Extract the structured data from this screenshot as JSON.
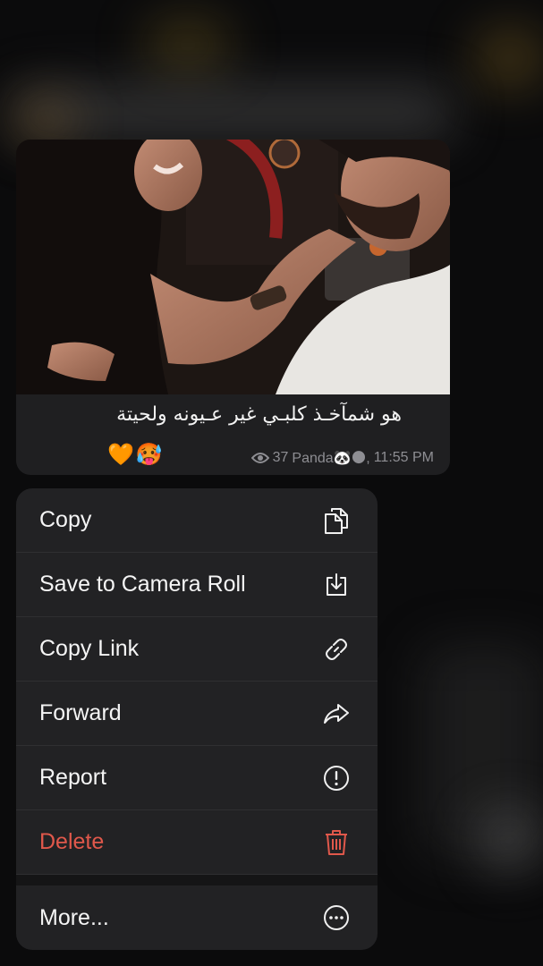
{
  "message": {
    "caption": "هو شمآخـذ كلبـي غير عـيونه ولحيتة",
    "emojis": "🧡🥵",
    "views": "37",
    "author": "Panda🐼🌑,",
    "time": "11:55 PM"
  },
  "menu": {
    "items": [
      {
        "label": "Copy",
        "icon": "copy-icon"
      },
      {
        "label": "Save to Camera Roll",
        "icon": "save-download-icon"
      },
      {
        "label": "Copy Link",
        "icon": "link-icon"
      },
      {
        "label": "Forward",
        "icon": "forward-arrow-icon"
      },
      {
        "label": "Report",
        "icon": "exclamation-circle-icon"
      },
      {
        "label": "Delete",
        "icon": "trash-icon",
        "color": "#e0584b"
      },
      {
        "label": "More...",
        "icon": "more-ellipsis-icon"
      }
    ]
  },
  "colors": {
    "menu_background": "#222224",
    "danger": "#e0584b",
    "bubble": "#1f1f21",
    "meta_text": "#8e8e93"
  }
}
